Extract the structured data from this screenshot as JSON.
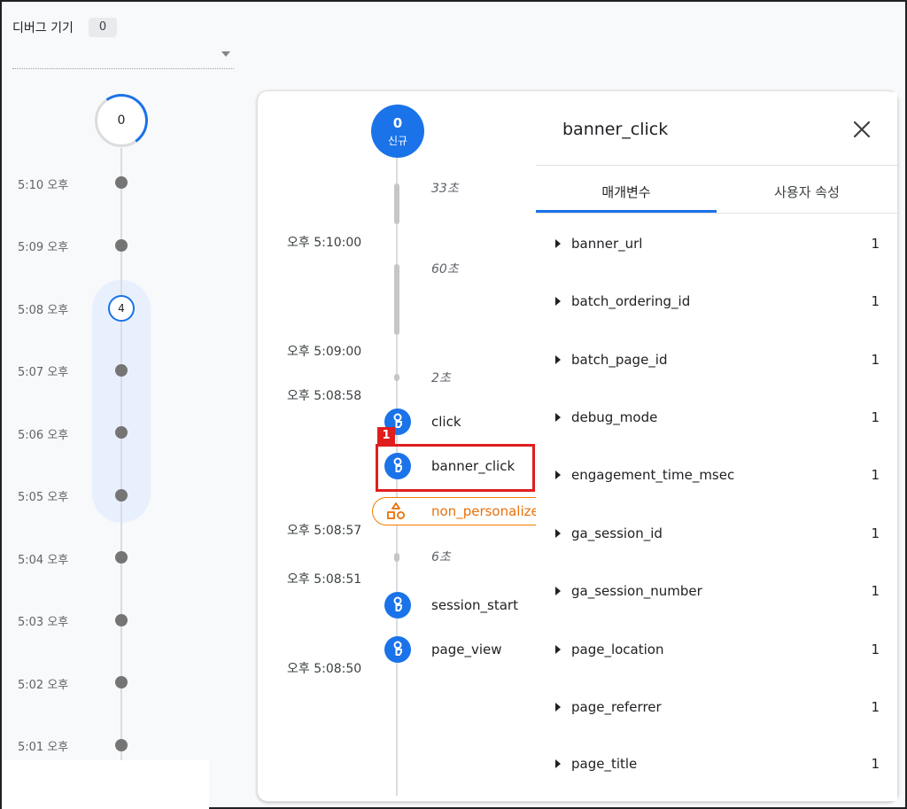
{
  "header": {
    "device_label": "디버그 기기",
    "device_count": "0"
  },
  "minutes": {
    "top_count": "0",
    "active_count": "4",
    "labels": [
      "5:10 오후",
      "5:09 오후",
      "5:08 오후",
      "5:07 오후",
      "5:06 오후",
      "5:05 오후",
      "5:04 오후",
      "5:03 오후",
      "5:02 오후",
      "5:01 오후"
    ]
  },
  "seconds": {
    "top_count": "0",
    "top_label": "신규",
    "times": [
      "오후 5:10:00",
      "오후 5:09:00",
      "오후 5:08:58",
      "오후 5:08:57",
      "오후 5:08:51",
      "오후 5:08:50"
    ],
    "gaps": [
      "33초",
      "60초",
      "2초",
      "6초"
    ],
    "events": [
      "click",
      "banner_click",
      "non_personalized_ads",
      "session_start",
      "page_view"
    ],
    "annotation": "1"
  },
  "detail": {
    "title": "banner_click",
    "tabs": [
      "매개변수",
      "사용자 속성"
    ],
    "params": [
      {
        "name": "banner_url",
        "count": "1"
      },
      {
        "name": "batch_ordering_id",
        "count": "1"
      },
      {
        "name": "batch_page_id",
        "count": "1"
      },
      {
        "name": "debug_mode",
        "count": "1"
      },
      {
        "name": "engagement_time_msec",
        "count": "1"
      },
      {
        "name": "ga_session_id",
        "count": "1"
      },
      {
        "name": "ga_session_number",
        "count": "1"
      },
      {
        "name": "page_location",
        "count": "1"
      },
      {
        "name": "page_referrer",
        "count": "1"
      },
      {
        "name": "page_title",
        "count": "1"
      }
    ]
  },
  "colors": {
    "accent": "#1a73e8",
    "warning": "#e8710a",
    "annotation": "#e01e1e"
  }
}
